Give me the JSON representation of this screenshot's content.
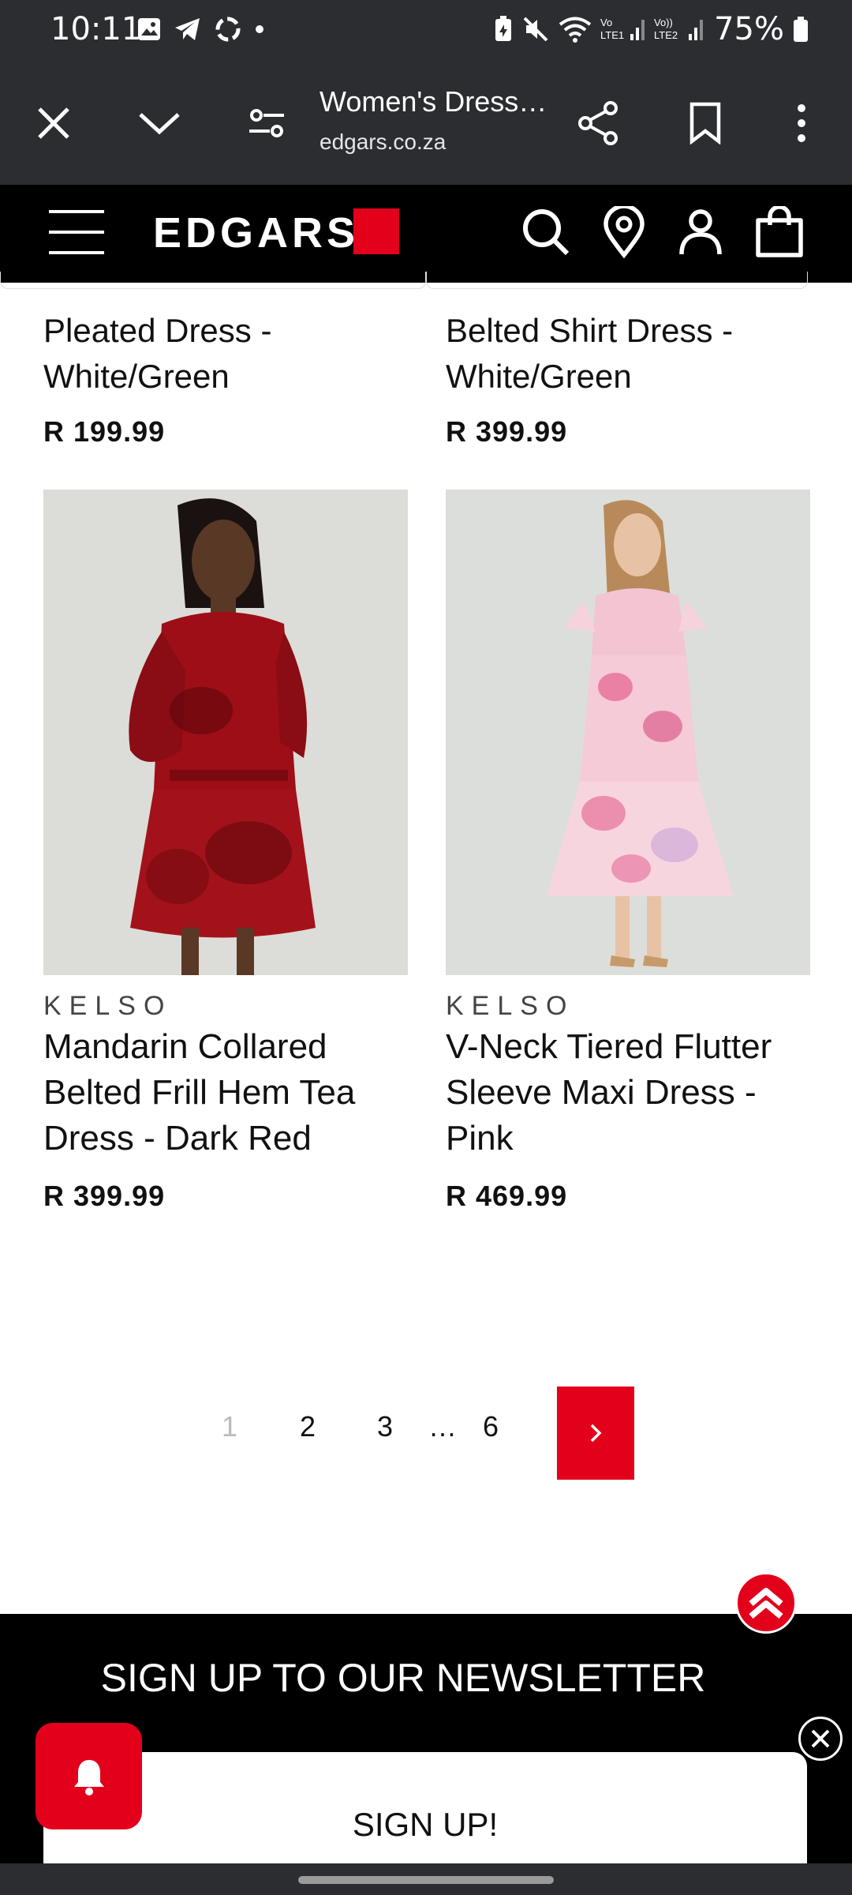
{
  "status_bar": {
    "time": "10:11",
    "battery": "75%",
    "left_icons": [
      "image-icon",
      "telegram-icon",
      "sync-icon",
      "dot-icon"
    ],
    "right_icons": [
      "battery-saver-icon",
      "mute-icon",
      "wifi-icon",
      "signal-lte1-icon",
      "signal-lte2-icon",
      "battery-icon"
    ]
  },
  "browser": {
    "title": "Women's Dress…",
    "url": "edgars.co.za"
  },
  "header": {
    "logo": "EDGARS",
    "accent_color": "#e3001b"
  },
  "products_top": [
    {
      "title_line_1": "Pleated Dress -",
      "title_line_2": "White/Green",
      "price": "R 199.99"
    },
    {
      "title_line_1": "Belted Shirt Dress -",
      "title_line_2": "White/Green",
      "price": "R 399.99"
    }
  ],
  "products": [
    {
      "brand": "KELSO",
      "name": "Mandarin Collared Belted Frill Hem Tea Dress - Dark Red",
      "price": "R 399.99"
    },
    {
      "brand": "KELSO",
      "name": "V-Neck Tiered Flutter Sleeve Maxi Dress - Pink",
      "price": "R 469.99"
    }
  ],
  "pagination": {
    "pages": [
      "1",
      "2",
      "3",
      "…",
      "6"
    ],
    "current_page": "1"
  },
  "newsletter": {
    "title": "SIGN UP TO OUR NEWSLETTER",
    "button_label": "SIGN UP!"
  }
}
